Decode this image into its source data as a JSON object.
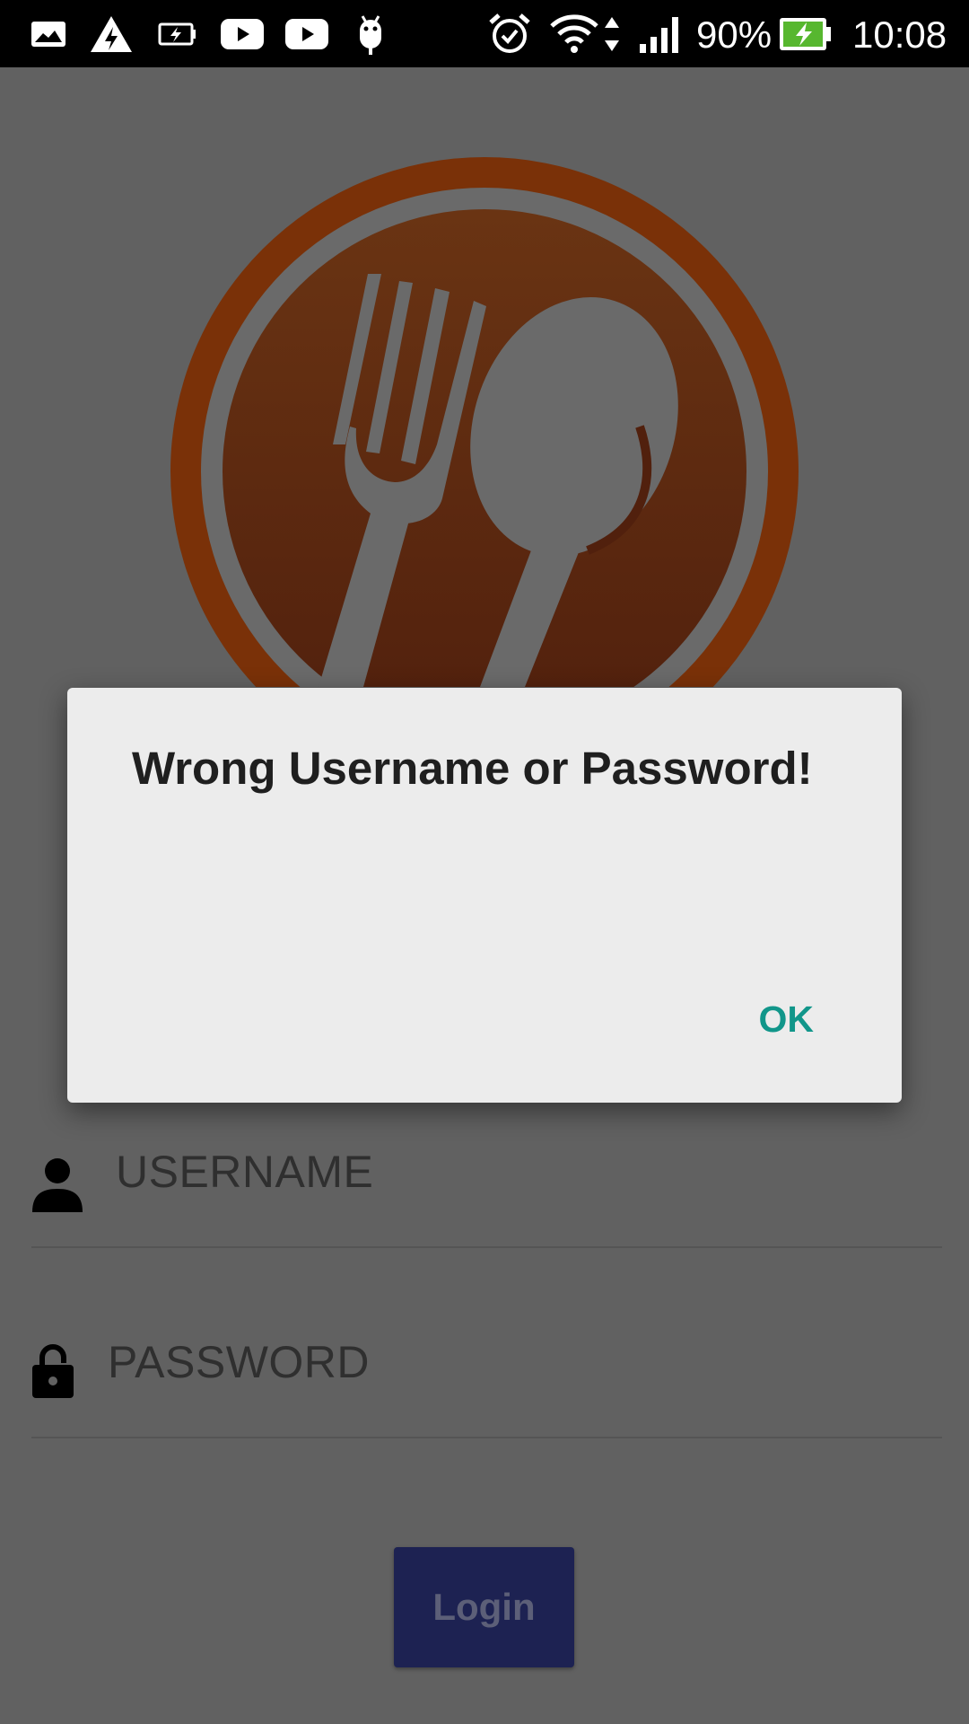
{
  "status_bar": {
    "battery_percent": "90%",
    "time": "10:08",
    "icons": [
      "gallery-icon",
      "vpn-warning-icon",
      "battery-charging-icon",
      "youtube-icon",
      "youtube-icon",
      "android-debug-icon",
      "alarm-icon",
      "wifi-icon",
      "data-arrows-icon",
      "signal-icon",
      "battery-icon"
    ]
  },
  "logo": {
    "icon": "fork-spoon-plate-logo",
    "color": "#7a3108"
  },
  "form": {
    "username_placeholder": "USERNAME",
    "password_placeholder": "PASSWORD",
    "login_label": "Login"
  },
  "dialog": {
    "title": "Wrong Username or Password!",
    "ok_label": "OK",
    "accent_color": "#11968a"
  }
}
